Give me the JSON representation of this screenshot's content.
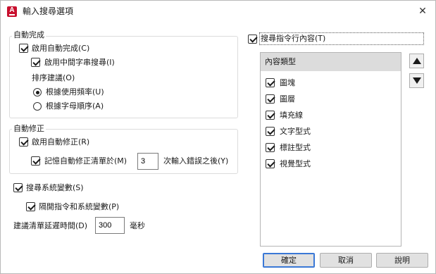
{
  "window": {
    "title": "輸入搜尋選項"
  },
  "autocomplete": {
    "group_label": "自動完成",
    "enable_label": "啟用自動完成(C)",
    "enable_checked": true,
    "midstring_label": "啟用中間字串搜尋(I)",
    "midstring_checked": true,
    "sort_label": "排序建議(O)",
    "sort_by_frequency_label": "根據使用頻率(U)",
    "sort_by_frequency_selected": true,
    "sort_alphabetical_label": "根據字母順序(A)",
    "sort_alphabetical_selected": false
  },
  "autocorrect": {
    "group_label": "自動修正",
    "enable_label": "啟用自動修正(R)",
    "enable_checked": true,
    "remember_label": "記憶自動修正清單於(M)",
    "remember_checked": true,
    "remember_value": "3",
    "remember_suffix": "次輸入錯誤之後(Y)"
  },
  "system_vars": {
    "search_label": "搜尋系統變數(S)",
    "search_checked": true,
    "separate_label": "隔開指令和系統變數(P)",
    "separate_checked": true
  },
  "delay": {
    "label": "建議清單延遲時間(D)",
    "value": "300",
    "unit": "毫秒"
  },
  "content_search": {
    "label": "搜尋指令行內容(T)",
    "checked": true,
    "list_header": "內容類型",
    "items": [
      {
        "label": "圖塊",
        "checked": true
      },
      {
        "label": "圖層",
        "checked": true
      },
      {
        "label": "填充線",
        "checked": true
      },
      {
        "label": "文字型式",
        "checked": true
      },
      {
        "label": "標註型式",
        "checked": true
      },
      {
        "label": "視覺型式",
        "checked": true
      }
    ]
  },
  "buttons": {
    "ok": "確定",
    "cancel": "取消",
    "help": "說明"
  }
}
